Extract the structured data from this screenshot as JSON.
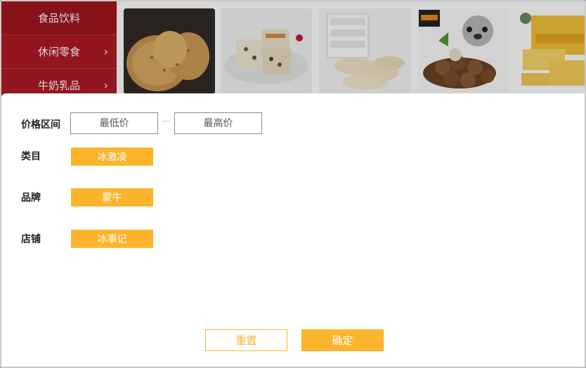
{
  "categories": [
    {
      "label": "食品饮料",
      "has_chevron": false
    },
    {
      "label": "休闲零食",
      "has_chevron": true
    },
    {
      "label": "牛奶乳品",
      "has_chevron": true
    }
  ],
  "chevron_glyph": "›",
  "products": [
    {
      "name": "biscuit-image"
    },
    {
      "name": "nougat-image"
    },
    {
      "name": "cake-rolls-image"
    },
    {
      "name": "macadamia-nuts-image"
    },
    {
      "name": "nabati-wafer-image"
    }
  ],
  "filter": {
    "price_label": "价格区间",
    "min_placeholder": "最低价",
    "max_placeholder": "最高价",
    "category_label": "类目",
    "category_value": "冰激凌",
    "brand_label": "品牌",
    "brand_value": "蒙牛",
    "shop_label": "店铺",
    "shop_value": "冰事记",
    "reset_label": "重置",
    "confirm_label": "确定"
  },
  "colors": {
    "accent": "#fbb42c",
    "sidebar": "#b01a25"
  }
}
